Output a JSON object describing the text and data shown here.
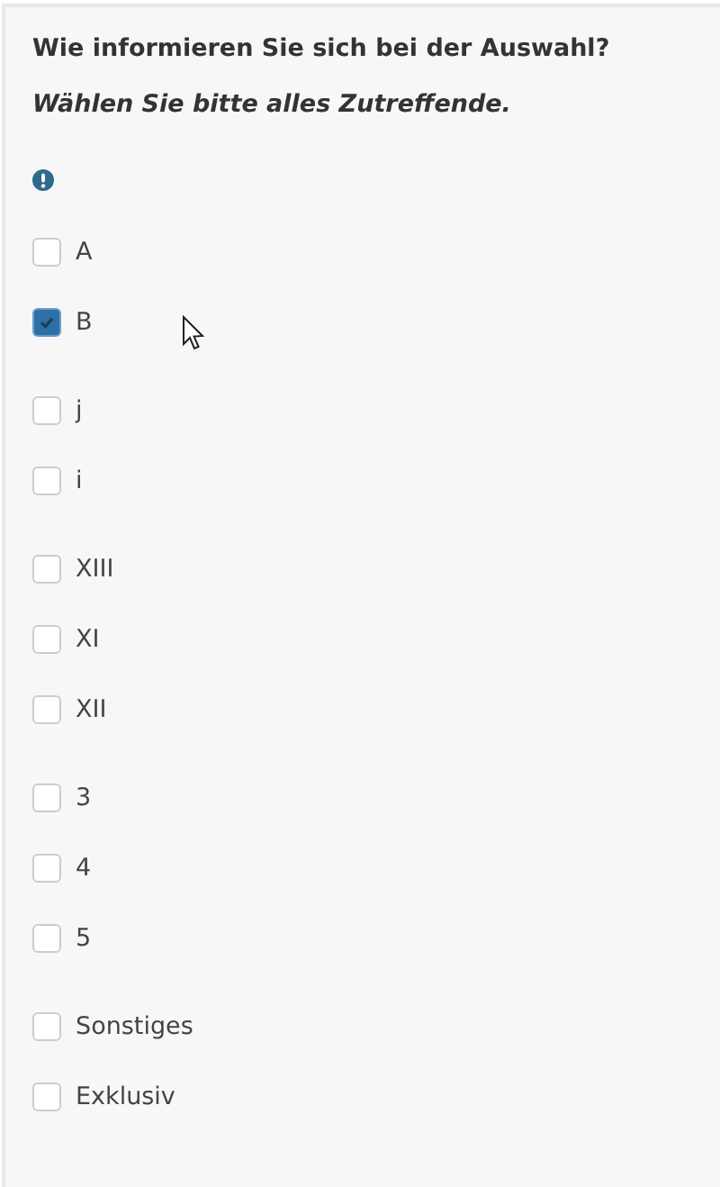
{
  "question": {
    "title": "Wie informieren Sie sich bei der Auswahl?",
    "instruction": "Wählen Sie bitte alles Zutreffende."
  },
  "option_groups": [
    {
      "options": [
        {
          "label": "A",
          "checked": false
        },
        {
          "label": "B",
          "checked": true
        }
      ]
    },
    {
      "options": [
        {
          "label": "j",
          "checked": false
        },
        {
          "label": "i",
          "checked": false
        }
      ]
    },
    {
      "options": [
        {
          "label": "XIII",
          "checked": false
        },
        {
          "label": "XI",
          "checked": false
        },
        {
          "label": "XII",
          "checked": false
        }
      ]
    },
    {
      "options": [
        {
          "label": "3",
          "checked": false
        },
        {
          "label": "4",
          "checked": false
        },
        {
          "label": "5",
          "checked": false
        }
      ]
    },
    {
      "options": [
        {
          "label": "Sonstiges",
          "checked": false
        },
        {
          "label": "Exklusiv",
          "checked": false
        }
      ]
    }
  ]
}
